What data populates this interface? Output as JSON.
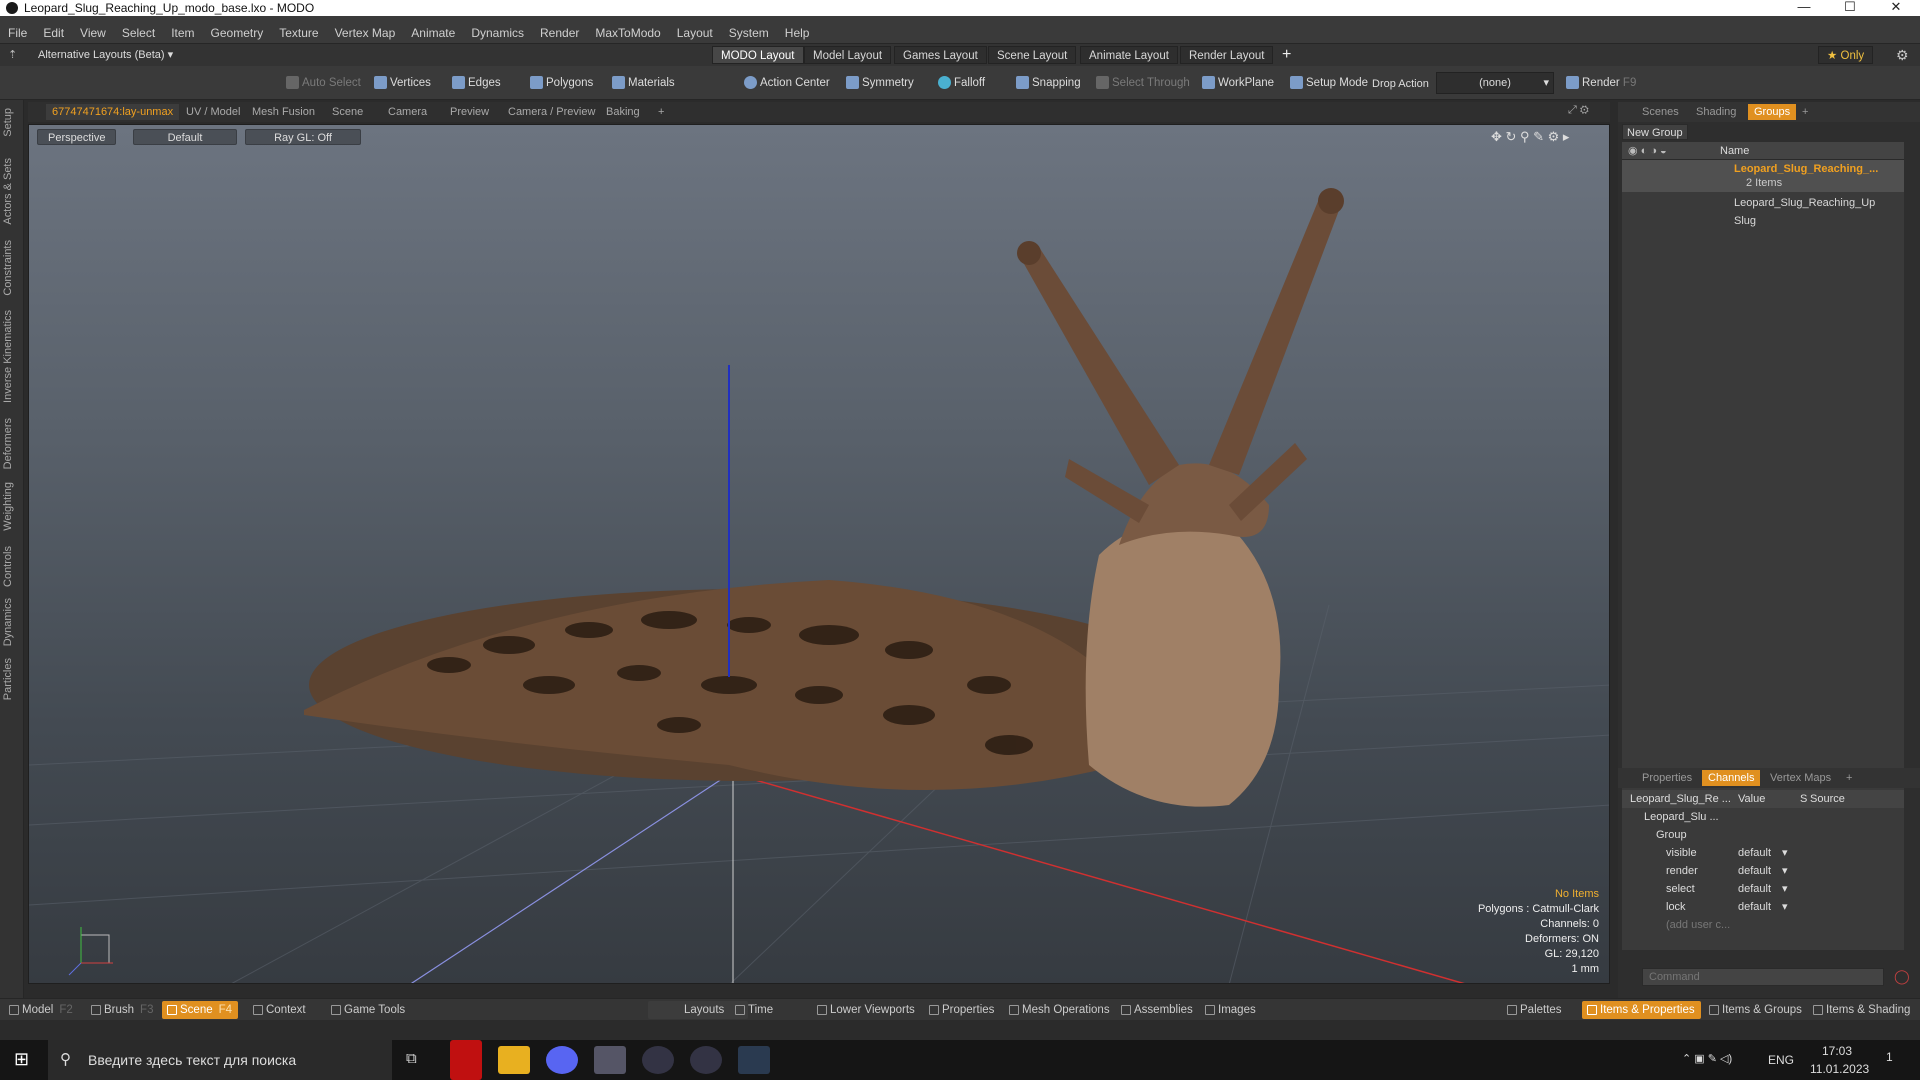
{
  "window": {
    "title": "Leopard_Slug_Reaching_Up_modo_base.lxo - MODO",
    "min": "—",
    "max": "☐",
    "close": "✕"
  },
  "menu": [
    "File",
    "Edit",
    "View",
    "Select",
    "Item",
    "Geometry",
    "Texture",
    "Vertex Map",
    "Animate",
    "Dynamics",
    "Render",
    "MaxToModo",
    "Layout",
    "System",
    "Help"
  ],
  "layoutbar": {
    "alt": "Alternative Layouts (Beta) ▾",
    "tabs": [
      "MODO Layout",
      "Model Layout",
      "Games Layout",
      "Scene Layout",
      "Animate Layout",
      "Render Layout"
    ],
    "add": "+",
    "only": "★ Only",
    "gear": "⚙"
  },
  "toolbar": {
    "auto_select": "Auto Select",
    "vertices": "Vertices",
    "edges": "Edges",
    "polygons": "Polygons",
    "materials": "Materials",
    "action_center": "Action Center",
    "symmetry": "Symmetry",
    "falloff": "Falloff",
    "snapping": "Snapping",
    "select_through": "Select Through",
    "workplane": "WorkPlane",
    "setup_mode": "Setup Mode",
    "drop_action": "Drop Action",
    "drop_value": "(none)",
    "render": "Render",
    "render_key": "F9"
  },
  "viewport_tabs": [
    "67747471674:lay-unmax",
    "UV / Model",
    "Mesh Fusion",
    "Scene",
    "Camera",
    "Preview",
    "Camera / Preview",
    "Baking",
    "+"
  ],
  "viewport": {
    "perspective": "Perspective",
    "default": "Default",
    "raygl": "Ray GL: Off"
  },
  "info": {
    "items": "No Items",
    "polygons": "Polygons : Catmull-Clark",
    "channels": "Channels: 0",
    "deformers": "Deformers: ON",
    "gl": "GL: 29,120",
    "scale": "1 mm"
  },
  "left_tabs": [
    "Setup",
    "Actors & Sets",
    "Constraints",
    "Inverse Kinematics",
    "Deformers",
    "Weighting",
    "Controls",
    "Dynamics",
    "Particles"
  ],
  "groups_panel": {
    "tabs": [
      "Scenes",
      "Shading",
      "Groups",
      "+"
    ],
    "new_group": "New Group",
    "col_name": "Name",
    "group_name": "Leopard_Slug_Reaching_...",
    "items_count": "2 Items",
    "item1": "Leopard_Slug_Reaching_Up",
    "item2": "Slug"
  },
  "channels_panel": {
    "tabs": [
      "Properties",
      "Channels",
      "Vertex Maps",
      "+"
    ],
    "col_item": "Leopard_Slug_Re ...",
    "col_value": "Value",
    "col_s": "S",
    "col_source": "Source",
    "root": "Leopard_Slu ...",
    "group": "Group",
    "rows": [
      {
        "name": "visible",
        "value": "default"
      },
      {
        "name": "render",
        "value": "default"
      },
      {
        "name": "select",
        "value": "default"
      },
      {
        "name": "lock",
        "value": "default"
      }
    ],
    "add_user": "(add user c..."
  },
  "command": {
    "placeholder": "Command"
  },
  "statusbar": {
    "model": "Model",
    "model_key": "F2",
    "brush": "Brush",
    "brush_key": "F3",
    "scene": "Scene",
    "scene_key": "F4",
    "context": "Context",
    "game_tools": "Game Tools",
    "layouts": "Layouts",
    "time": "Time",
    "lower_viewports": "Lower Viewports",
    "properties": "Properties",
    "mesh_operations": "Mesh Operations",
    "assemblies": "Assemblies",
    "images": "Images",
    "palettes": "Palettes",
    "items_properties": "Items & Properties",
    "items_groups": "Items & Groups",
    "items_shading": "Items & Shading"
  },
  "taskbar": {
    "search": "Введите здесь текст для поиска",
    "lang": "ENG",
    "time": "17:03",
    "date": "11.01.2023",
    "notif": "1"
  }
}
